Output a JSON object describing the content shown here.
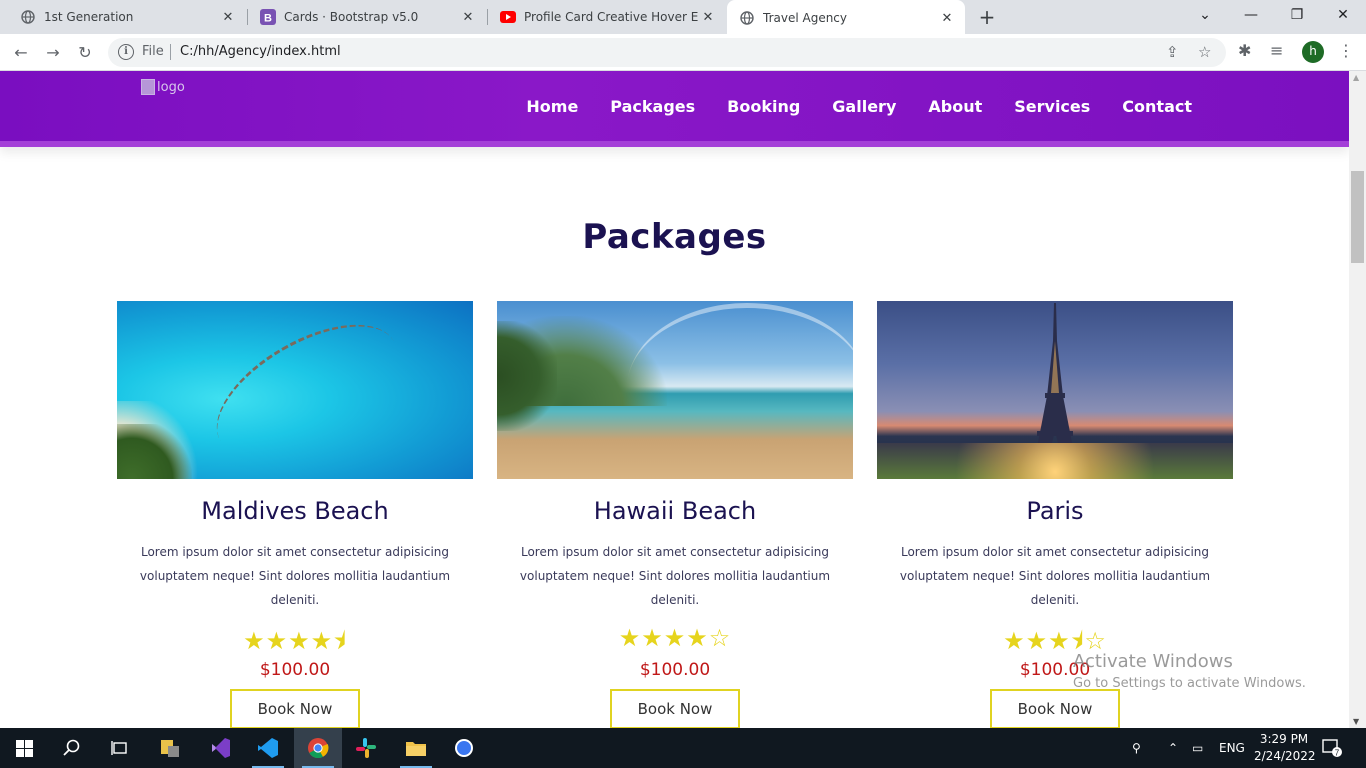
{
  "browser": {
    "tabs": [
      {
        "title": "1st Generation",
        "icon": "globe-icon"
      },
      {
        "title": "Cards · Bootstrap v5.0",
        "icon": "bootstrap-icon"
      },
      {
        "title": "Profile Card Creative Hover Effect",
        "icon": "youtube-icon"
      },
      {
        "title": "Travel Agency",
        "icon": "globe-icon"
      }
    ],
    "address_label": "File",
    "url": "C:/hh/Agency/index.html",
    "profile_initial": "h"
  },
  "site": {
    "logo_alt": "logo",
    "nav": [
      "Home",
      "Packages",
      "Booking",
      "Gallery",
      "About",
      "Services",
      "Contact"
    ],
    "section_title": "Packages",
    "cards": [
      {
        "title": "Maldives Beach",
        "desc": "Lorem ipsum dolor sit amet consectetur adipisicing voluptatem neque! Sint dolores mollitia laudantium deleniti.",
        "rating": 4.5,
        "stars": "★★★★⯨",
        "price": "$100.00",
        "button": "Book Now"
      },
      {
        "title": "Hawaii Beach",
        "desc": "Lorem ipsum dolor sit amet consectetur adipisicing voluptatem neque! Sint dolores mollitia laudantium deleniti.",
        "rating": 4,
        "stars": "★★★★☆",
        "price": "$100.00",
        "button": "Book Now"
      },
      {
        "title": "Paris",
        "desc": "Lorem ipsum dolor sit amet consectetur adipisicing voluptatem neque! Sint dolores mollitia laudantium deleniti.",
        "rating": 3.5,
        "stars": "★★★⯨☆",
        "price": "$100.00",
        "button": "Book Now"
      }
    ]
  },
  "watermark": {
    "line1": "Activate Windows",
    "line2": "Go to Settings to activate Windows."
  },
  "taskbar": {
    "lang": "ENG",
    "time": "3:29 PM",
    "date": "2/24/2022",
    "notifications": "7"
  },
  "colors": {
    "header_purple": "#7a0ec0",
    "title_navy": "#1b1251",
    "star_yellow": "#e6d41d",
    "price_red": "#c01818",
    "button_border": "#e0d321"
  }
}
